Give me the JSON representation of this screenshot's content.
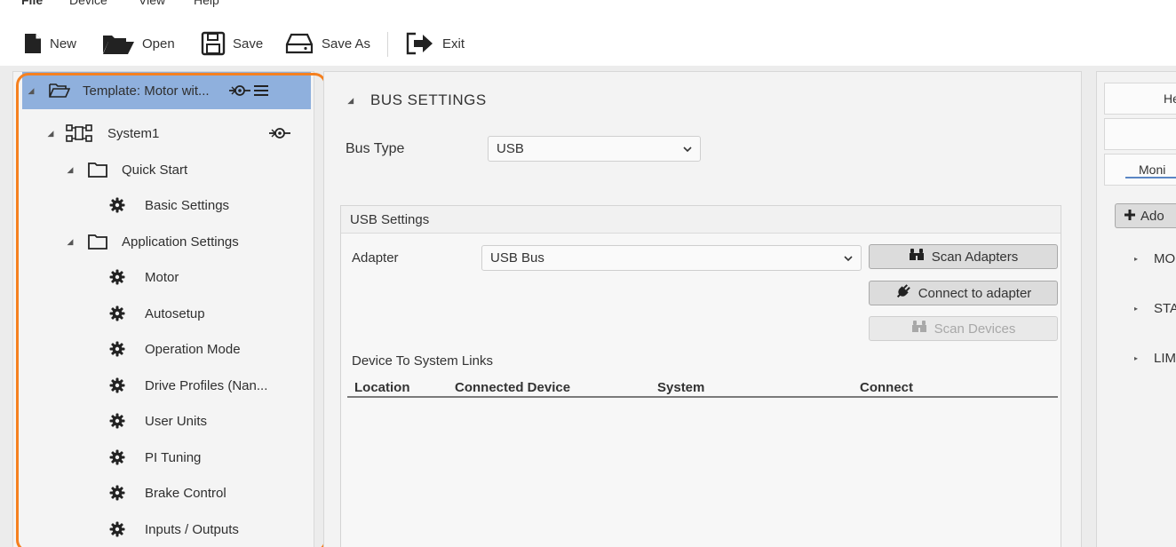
{
  "menu": [
    "File",
    "Device",
    "View",
    "Help"
  ],
  "toolbar": {
    "new_label": "New",
    "open_label": "Open",
    "save_label": "Save",
    "save_as_label": "Save As",
    "exit_label": "Exit"
  },
  "tree": {
    "items": [
      {
        "label": "Template: Motor wit...",
        "icon": "folder-open-icon"
      },
      {
        "label": "System1",
        "icon": "system-icon"
      },
      {
        "label": "Quick Start",
        "icon": "folder-icon"
      },
      {
        "label": "Basic Settings",
        "icon": "gear-icon"
      },
      {
        "label": "Application Settings",
        "icon": "folder-icon"
      },
      {
        "label": "Motor",
        "icon": "gear-icon"
      },
      {
        "label": "Autosetup",
        "icon": "gear-icon"
      },
      {
        "label": "Operation Mode",
        "icon": "gear-icon"
      },
      {
        "label": "Drive Profiles (Nan...",
        "icon": "gear-icon"
      },
      {
        "label": "User Units",
        "icon": "gear-icon"
      },
      {
        "label": "PI Tuning",
        "icon": "gear-icon"
      },
      {
        "label": "Brake Control",
        "icon": "gear-icon"
      },
      {
        "label": "Inputs / Outputs",
        "icon": "gear-icon"
      }
    ]
  },
  "bus_settings": {
    "title": "BUS SETTINGS",
    "bus_type_label": "Bus Type",
    "bus_type_value": "USB",
    "usb_group_title": "USB Settings",
    "adapter_label": "Adapter",
    "adapter_value": "USB Bus",
    "scan_adapters_label": "Scan Adapters",
    "connect_adapter_label": "Connect to adapter",
    "scan_devices_label": "Scan Devices",
    "links_label": "Device To System Links",
    "columns": [
      "Location",
      "Connected Device",
      "System",
      "Connect"
    ]
  },
  "right_panel": {
    "tab_top": "He",
    "tab_monitor": "Moni",
    "add_label": "Ado",
    "items": [
      "MO",
      "STA",
      "LIM"
    ]
  },
  "colors": {
    "selection": "#8fb0dd",
    "highlight": "#f5801f",
    "accent": "#5b86c5"
  }
}
